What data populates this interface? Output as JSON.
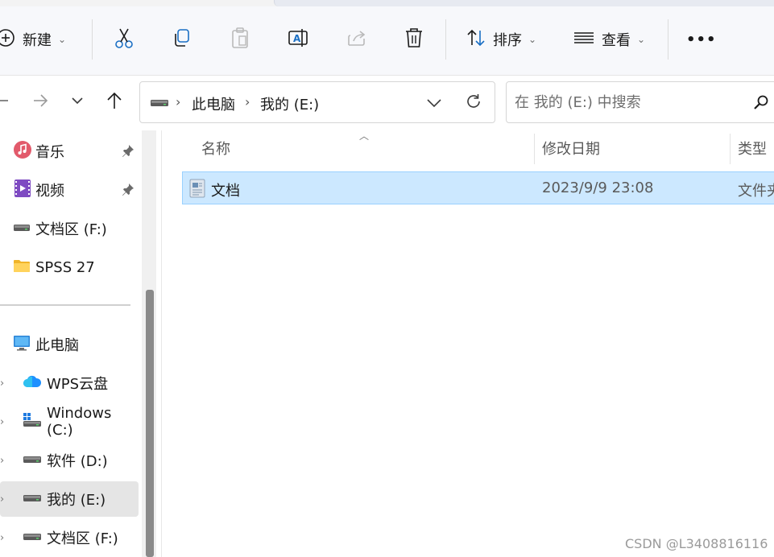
{
  "toolbar": {
    "new_label": "新建",
    "sort_label": "排序",
    "view_label": "查看",
    "more_label": "•••"
  },
  "address": {
    "crumbs": [
      "此电脑",
      "我的 (E:)"
    ]
  },
  "search": {
    "placeholder": "在 我的 (E:) 中搜索"
  },
  "nav": {
    "quick_access": [
      {
        "label": "音乐",
        "pinned": true,
        "icon": "music-icon"
      },
      {
        "label": "视频",
        "pinned": true,
        "icon": "video-icon"
      },
      {
        "label": "文档区 (F:)",
        "pinned": false,
        "icon": "drive-icon"
      },
      {
        "label": "SPSS 27",
        "pinned": false,
        "icon": "folder-icon"
      }
    ],
    "this_pc": {
      "label": "此电脑",
      "icon": "computer-icon"
    },
    "drives": [
      {
        "label": "WPS云盘",
        "icon": "cloud-icon"
      },
      {
        "label": "Windows (C:)",
        "icon": "windows-drive-icon"
      },
      {
        "label": "软件 (D:)",
        "icon": "drive-icon"
      },
      {
        "label": "我的 (E:)",
        "icon": "drive-icon",
        "selected": true
      },
      {
        "label": "文档区 (F:)",
        "icon": "drive-icon"
      }
    ]
  },
  "columns": {
    "name": "名称",
    "modified": "修改日期",
    "type": "类型"
  },
  "files": [
    {
      "name": "文档",
      "modified": "2023/9/9 23:08",
      "type": "文件夹",
      "icon": "document-folder-icon",
      "selected": true
    }
  ],
  "watermark": "CSDN @L3408816116",
  "colors": {
    "selection_bg": "#cce8ff",
    "selection_border": "#99d1ff",
    "accent_blue": "#0067c0"
  }
}
